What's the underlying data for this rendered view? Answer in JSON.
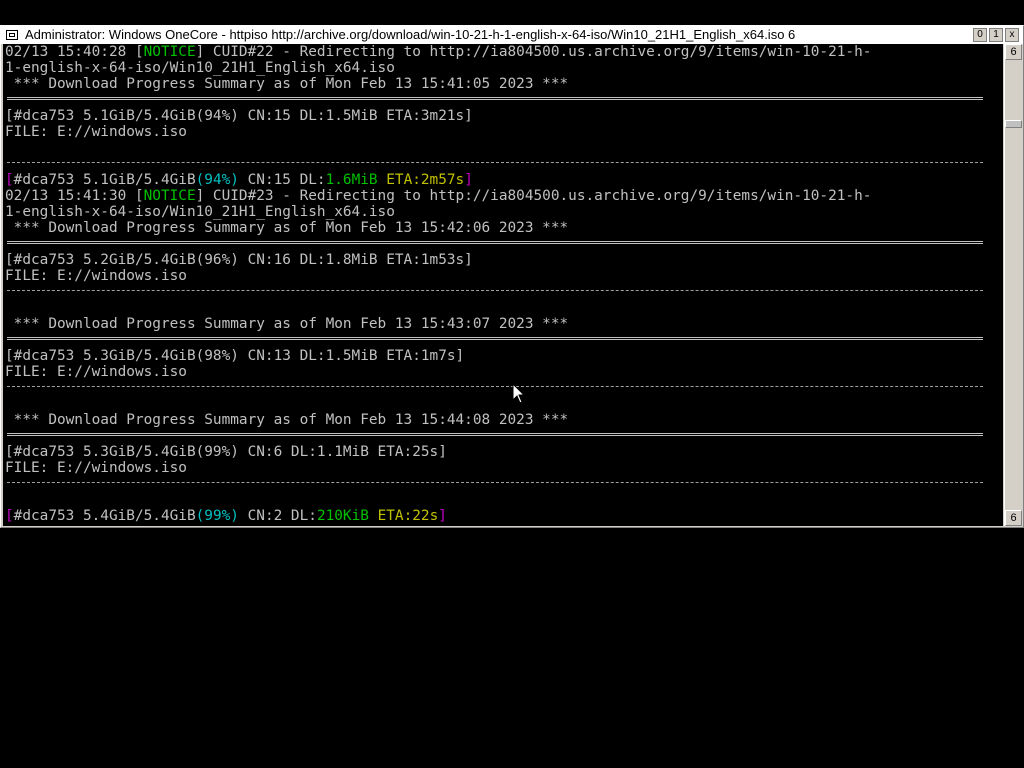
{
  "window": {
    "title": "Administrator:  Windows OneCore - httpiso  http://archive.org/download/win-10-21-h-1-english-x-64-iso/Win10_21H1_English_x64.iso 6",
    "controls": {
      "minimize": "0",
      "maximize": "1",
      "close": "x"
    },
    "scroll_up": "6",
    "scroll_down": "6"
  },
  "console": {
    "l1": {
      "a": "02/13 15:40:28 [",
      "notice": "NOTICE",
      "b": "] CUID#22 - Redirecting to http://ia804500.us.archive.org/9/items/win-10-21-h-"
    },
    "l2": "1-english-x-64-iso/Win10_21H1_English_x64.iso",
    "l3": " *** Download Progress Summary as of Mon Feb 13 15:41:05 2023 ***",
    "l5": "[#dca753 5.1GiB/5.4GiB(94%) CN:15 DL:1.5MiB ETA:3m21s]",
    "l6": "FILE: E://windows.iso",
    "l9": {
      "br1": "[",
      "id": "#dca753 5.1GiB/5.4GiB",
      "pct": "(94%)",
      "cn": " CN:15 DL:",
      "dl": "1.6MiB",
      "eta": " ETA:2m57s",
      "br2": "]"
    },
    "l10": {
      "a": "02/13 15:41:30 [",
      "notice": "NOTICE",
      "b": "] CUID#23 - Redirecting to http://ia804500.us.archive.org/9/items/win-10-21-h-"
    },
    "l11": "1-english-x-64-iso/Win10_21H1_English_x64.iso",
    "l12": " *** Download Progress Summary as of Mon Feb 13 15:42:06 2023 ***",
    "l14": "[#dca753 5.2GiB/5.4GiB(96%) CN:16 DL:1.8MiB ETA:1m53s]",
    "l15": "FILE: E://windows.iso",
    "l18": " *** Download Progress Summary as of Mon Feb 13 15:43:07 2023 ***",
    "l20": "[#dca753 5.3GiB/5.4GiB(98%) CN:13 DL:1.5MiB ETA:1m7s]",
    "l21": "FILE: E://windows.iso",
    "l24": " *** Download Progress Summary as of Mon Feb 13 15:44:08 2023 ***",
    "l26": "[#dca753 5.3GiB/5.4GiB(99%) CN:6 DL:1.1MiB ETA:25s]",
    "l27": "FILE: E://windows.iso",
    "l30": {
      "br1": "[",
      "id": "#dca753 5.4GiB/5.4GiB",
      "pct": "(99%)",
      "cn": " CN:2 DL:",
      "dl": "210KiB",
      "eta": " ETA:22s",
      "br2": "]"
    }
  },
  "colors": {
    "magenta": "#c000c0",
    "green": "#00c000",
    "yellow": "#c0c000",
    "cyan": "#00c0c0",
    "text": "#c0c0c0"
  },
  "icons": [
    "system-menu-icon",
    "mouse-pointer-icon"
  ]
}
